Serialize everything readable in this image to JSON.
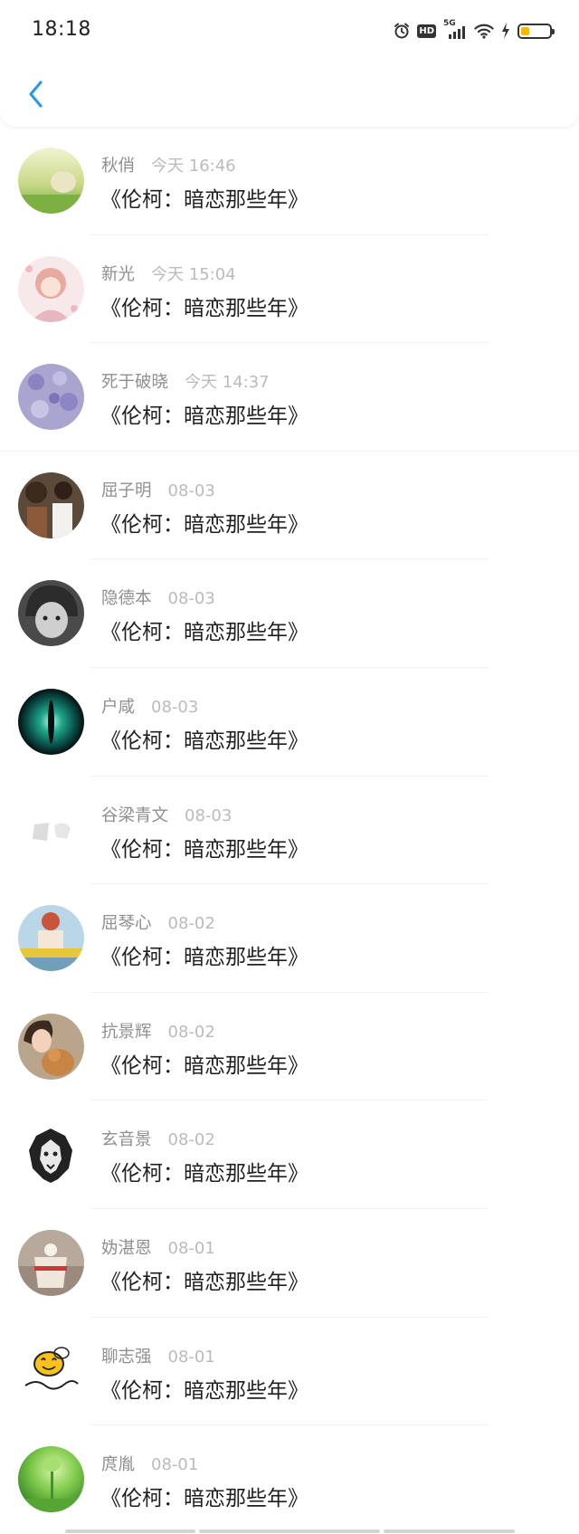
{
  "status_bar": {
    "time": "18:18",
    "icons": [
      "alarm-icon",
      "hd-icon",
      "5g-signal-icon",
      "wifi-icon",
      "charging-icon",
      "battery-icon"
    ],
    "hd_label": "HD",
    "network_label": "5G",
    "battery_level": 0.3,
    "battery_color": "#f5b800"
  },
  "header": {
    "back_icon": "chevron-left-icon",
    "accent_color": "#2c9ae8"
  },
  "items": [
    {
      "name": "秋俏",
      "time": "今天 16:46",
      "title": "《伦柯：暗恋那些年》"
    },
    {
      "name": "新光",
      "time": "今天 15:04",
      "title": "《伦柯：暗恋那些年》"
    },
    {
      "name": "死于破晓",
      "time": "今天 14:37",
      "title": "《伦柯：暗恋那些年》"
    },
    {
      "name": "屈子明",
      "time": "08-03",
      "title": "《伦柯：暗恋那些年》"
    },
    {
      "name": "隐德本",
      "time": "08-03",
      "title": "《伦柯：暗恋那些年》"
    },
    {
      "name": "户咸",
      "time": "08-03",
      "title": "《伦柯：暗恋那些年》"
    },
    {
      "name": "谷梁青文",
      "time": "08-03",
      "title": "《伦柯：暗恋那些年》"
    },
    {
      "name": "屈琴心",
      "time": "08-02",
      "title": "《伦柯：暗恋那些年》"
    },
    {
      "name": "抗景辉",
      "time": "08-02",
      "title": "《伦柯：暗恋那些年》"
    },
    {
      "name": "玄音景",
      "time": "08-02",
      "title": "《伦柯：暗恋那些年》"
    },
    {
      "name": "妫湛恩",
      "time": "08-01",
      "title": "《伦柯：暗恋那些年》"
    },
    {
      "name": "聊志强",
      "time": "08-01",
      "title": "《伦柯：暗恋那些年》"
    },
    {
      "name": "庹胤",
      "time": "08-01",
      "title": "《伦柯：暗恋那些年》"
    }
  ]
}
